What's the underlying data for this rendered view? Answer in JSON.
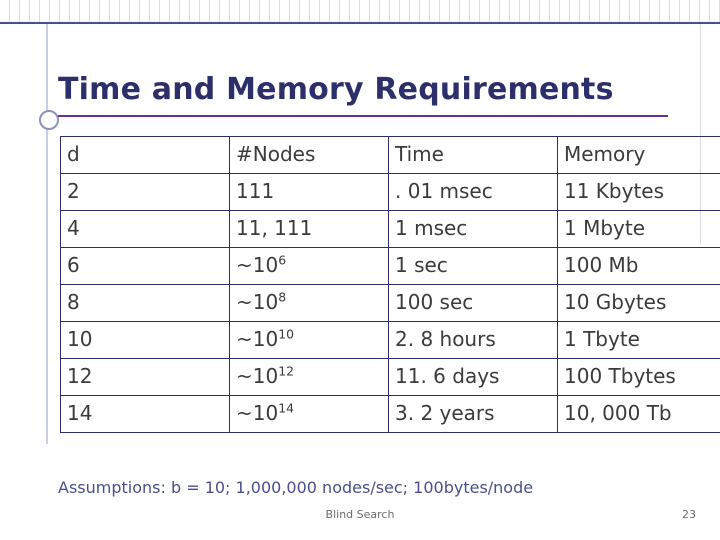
{
  "slide": {
    "title": "Time and Memory Requirements",
    "assumptions": "Assumptions: b = 10; 1,000,000 nodes/sec; 100bytes/node",
    "footer_label": "Blind Search",
    "page_number": "23",
    "accent_color": "#2d2f6b",
    "underline_color": "#6b2f8c"
  },
  "table": {
    "headers": {
      "depth": "d",
      "nodes": "#Nodes",
      "time": "Time",
      "memory": "Memory"
    },
    "rows": [
      {
        "depth": "2",
        "nodes_base": "111",
        "nodes_exp": "",
        "time": ". 01 msec",
        "memory": "11 Kbytes"
      },
      {
        "depth": "4",
        "nodes_base": "11, 111",
        "nodes_exp": "",
        "time": "1 msec",
        "memory": "1 Mbyte"
      },
      {
        "depth": "6",
        "nodes_base": "~10",
        "nodes_exp": "6",
        "time": "1 sec",
        "memory": "100 Mb"
      },
      {
        "depth": "8",
        "nodes_base": "~10",
        "nodes_exp": "8",
        "time": "100 sec",
        "memory": "10 Gbytes"
      },
      {
        "depth": "10",
        "nodes_base": "~10",
        "nodes_exp": "10",
        "time": "2. 8 hours",
        "memory": "1 Tbyte"
      },
      {
        "depth": "12",
        "nodes_base": "~10",
        "nodes_exp": "12",
        "time": "11. 6 days",
        "memory": "100 Tbytes"
      },
      {
        "depth": "14",
        "nodes_base": "~10",
        "nodes_exp": "14",
        "time": "3. 2 years",
        "memory": "10, 000 Tb"
      }
    ]
  }
}
